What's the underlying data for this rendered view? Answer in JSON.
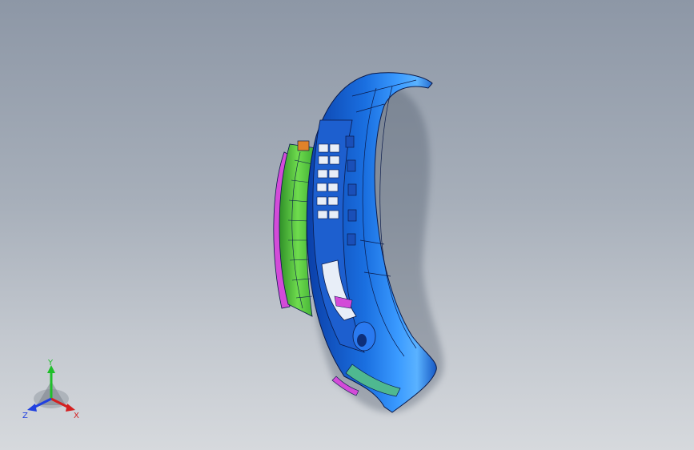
{
  "viewport": {
    "background_top": "#8d97a6",
    "background_bottom": "#d6d9dd"
  },
  "model": {
    "icon": "bumper-assembly-model",
    "colors": {
      "shell": "#1a6fe0",
      "shell_highlight": "#5ab2ff",
      "inner_green": "#4cc23c",
      "magenta": "#d34bd8",
      "orange": "#e0822a",
      "edge": "#0a1a4a"
    }
  },
  "triad": {
    "y_label": "Y",
    "x_label": "X",
    "z_label": "Z",
    "y_color": "#1fbf2a",
    "x_color": "#d42020",
    "z_color": "#2040e0"
  }
}
